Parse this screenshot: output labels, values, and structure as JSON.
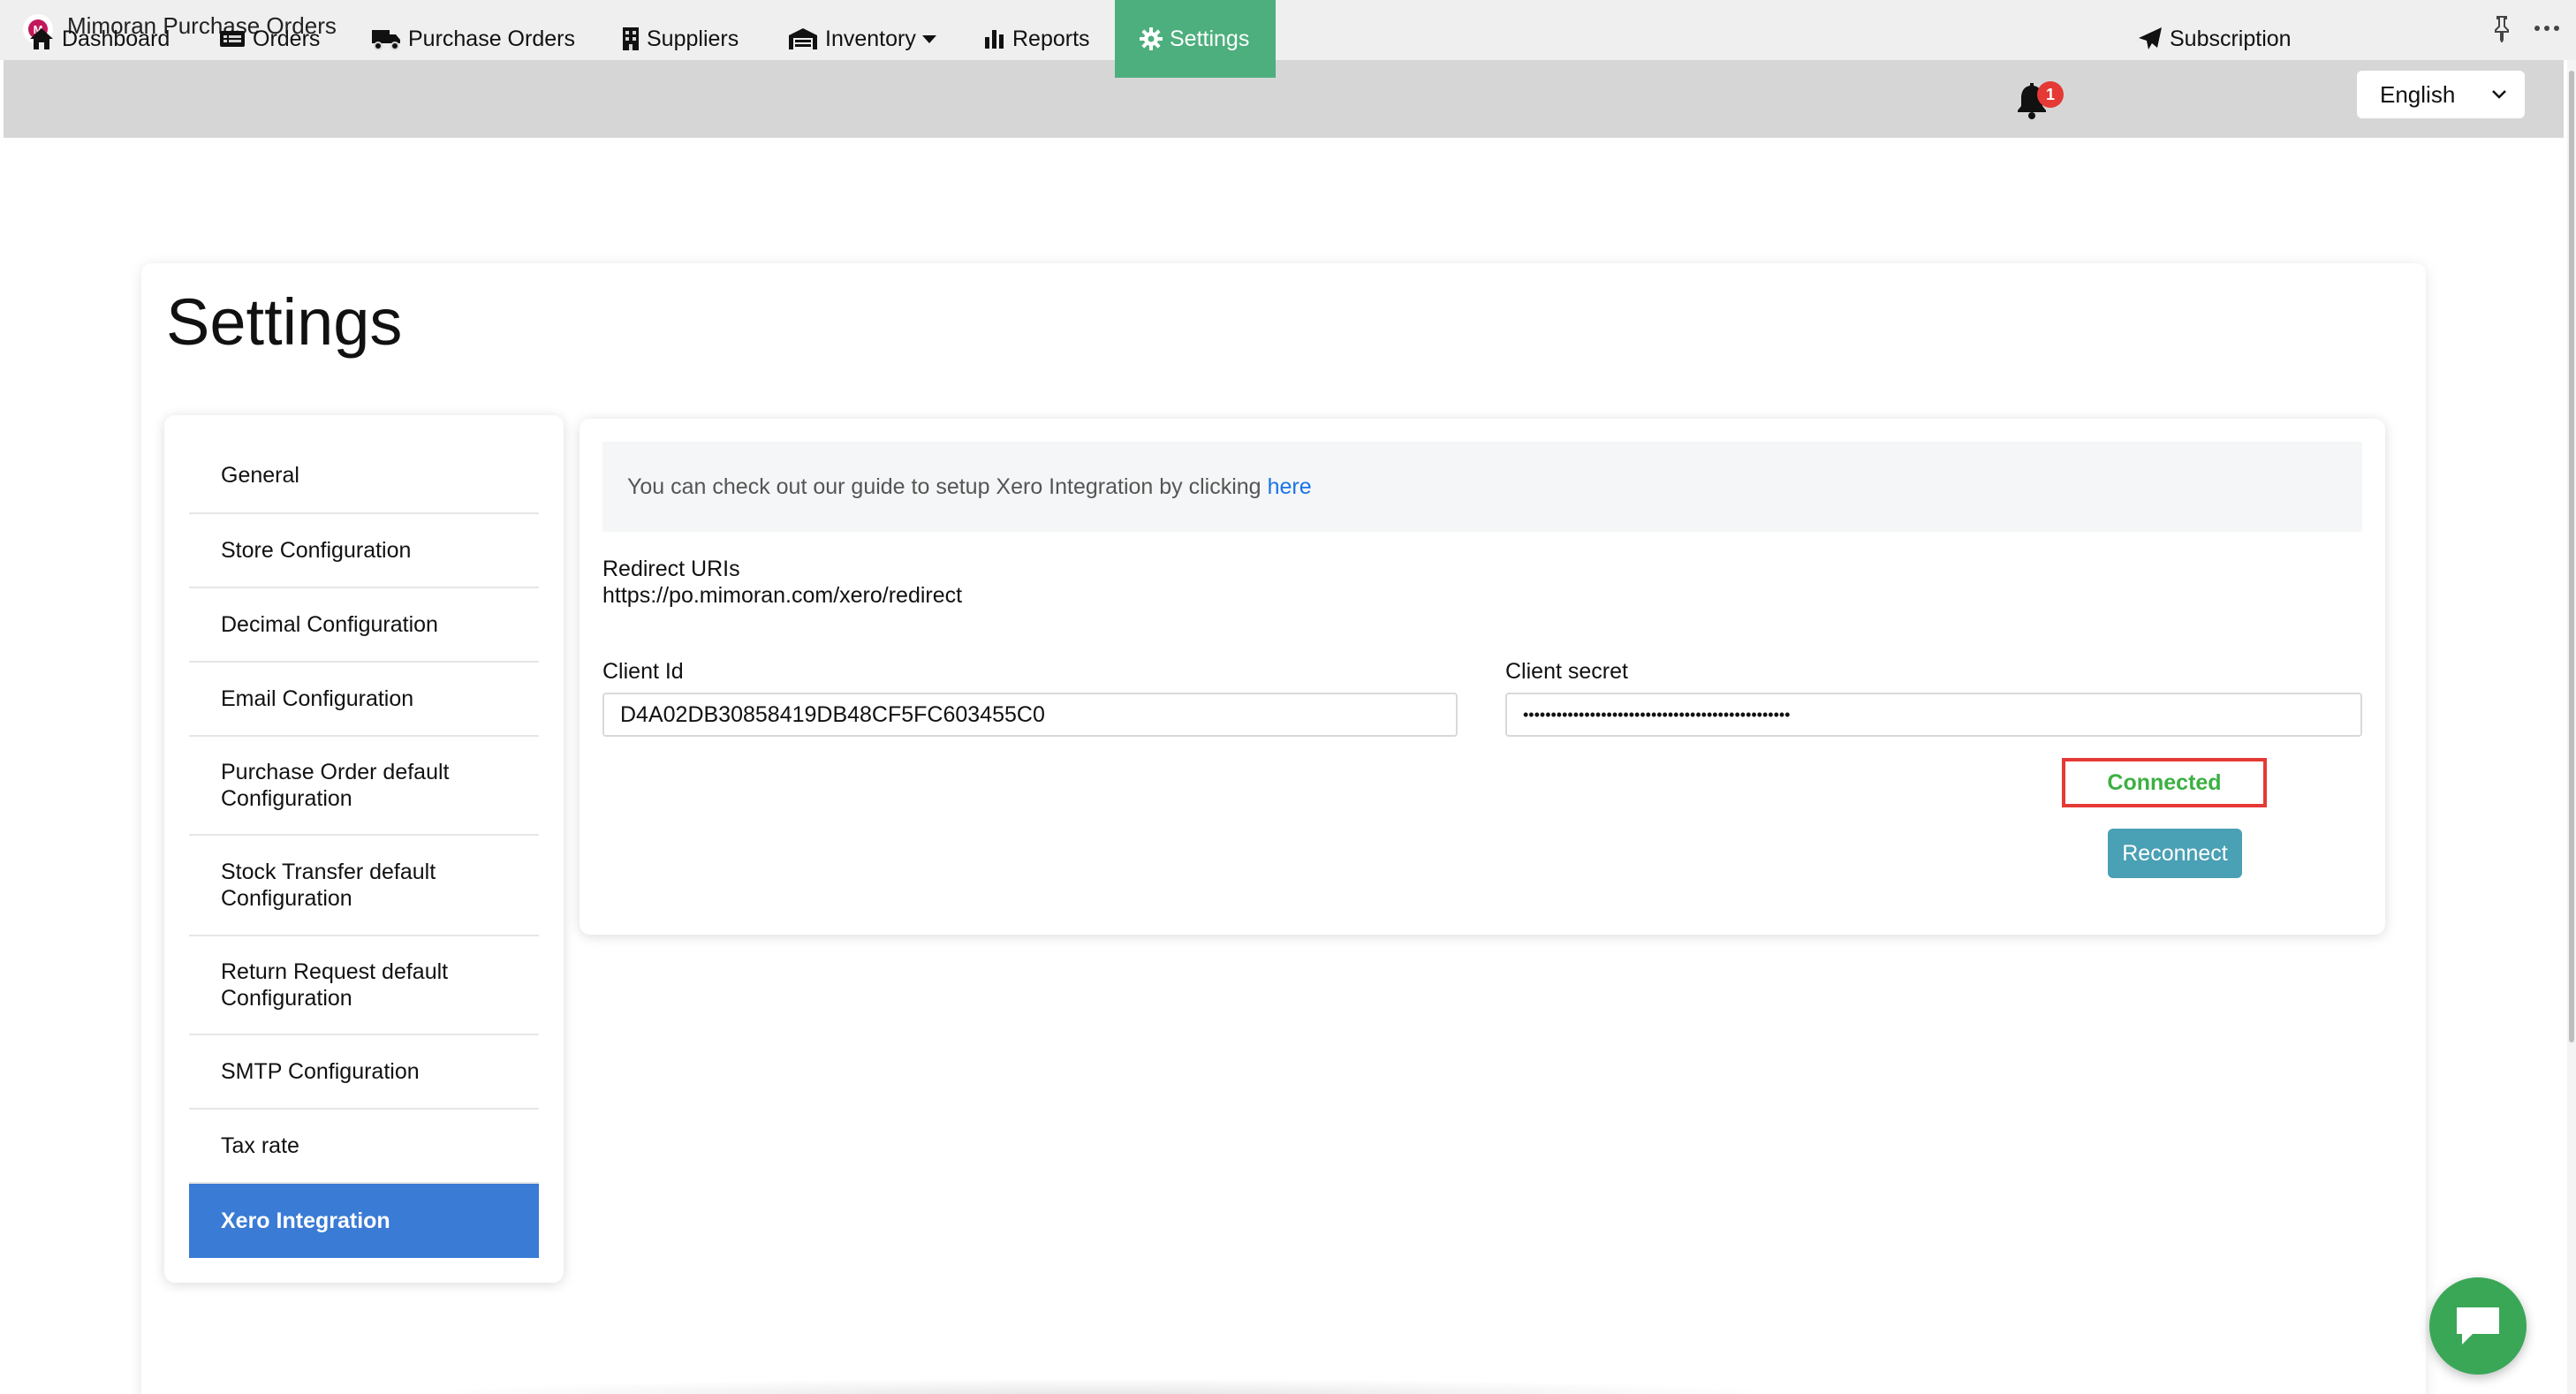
{
  "window": {
    "title": "Mimoran Purchase Orders",
    "logo_text": "M"
  },
  "nav": {
    "items": [
      {
        "label": "Dashboard",
        "icon": "home-icon"
      },
      {
        "label": "Orders",
        "icon": "orders-icon"
      },
      {
        "label": "Purchase Orders",
        "icon": "truck-icon"
      },
      {
        "label": "Suppliers",
        "icon": "building-icon"
      },
      {
        "label": "Inventory",
        "icon": "warehouse-icon"
      },
      {
        "label": "Reports",
        "icon": "bar-chart-icon"
      },
      {
        "label": "Settings",
        "icon": "gear-icon",
        "active": true
      }
    ],
    "notification_count": "1",
    "subscription_label": "Subscription",
    "language": "English"
  },
  "page": {
    "title": "Settings"
  },
  "sidebar": {
    "items": [
      {
        "label": "General"
      },
      {
        "label": "Store Configuration"
      },
      {
        "label": "Decimal Configuration"
      },
      {
        "label": "Email Configuration"
      },
      {
        "label": "Purchase Order default Configuration"
      },
      {
        "label": "Stock Transfer default Configuration"
      },
      {
        "label": "Return Request default Configuration"
      },
      {
        "label": "SMTP Configuration"
      },
      {
        "label": "Tax rate"
      },
      {
        "label": "Xero Integration",
        "active": true
      }
    ]
  },
  "xero": {
    "guide_text": "You can check out our guide to setup Xero Integration by clicking",
    "guide_link": "here",
    "redirect_label": "Redirect URIs",
    "redirect_value": "https://po.mimoran.com/xero/redirect",
    "client_id_label": "Client Id",
    "client_id_value": "D4A02DB30858419DB48CF5FC603455C0",
    "client_secret_label": "Client secret",
    "client_secret_value": "••••••••••••••••••••••••••••••••••••••••••••••••",
    "status": "Connected",
    "reconnect_label": "Reconnect"
  },
  "colors": {
    "active_nav": "#4caf7d",
    "active_sidebar": "#3a7bd5",
    "connected_text": "#3cb043",
    "highlight_border": "#e53935",
    "reconnect_button": "#4aa0b4",
    "chat_button": "#3aa757"
  }
}
